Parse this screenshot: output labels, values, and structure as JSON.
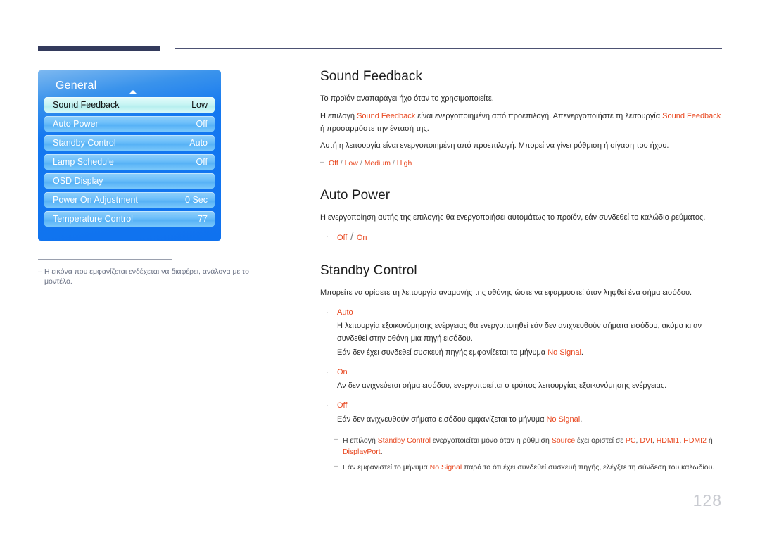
{
  "header": {
    "rule_thick_color": "#333a5c",
    "rule_thin_color": "#4d5273"
  },
  "osd": {
    "title": "General",
    "rows": [
      {
        "label": "Sound Feedback",
        "value": "Low",
        "selected": true
      },
      {
        "label": "Auto Power",
        "value": "Off",
        "selected": false
      },
      {
        "label": "Standby Control",
        "value": "Auto",
        "selected": false
      },
      {
        "label": "Lamp Schedule",
        "value": "Off",
        "selected": false
      },
      {
        "label": "OSD Display",
        "value": "",
        "selected": false
      },
      {
        "label": "Power On Adjustment",
        "value": "0 Sec",
        "selected": false
      },
      {
        "label": "Temperature Control",
        "value": "77",
        "selected": false
      }
    ],
    "caption_dash": "–",
    "caption": "Η εικόνα που εμφανίζεται ενδέχεται να διαφέρει, ανάλογα με το μοντέλο."
  },
  "sections": {
    "sound_feedback": {
      "title": "Sound Feedback",
      "p1": "Το προϊόν αναπαράγει ήχο όταν το χρησιμοποιείτε.",
      "p2_a": "Η επιλογή ",
      "p2_hl1": "Sound Feedback",
      "p2_b": " είναι ενεργοποιημένη από προεπιλογή. Απενεργοποιήστε τη λειτουργία ",
      "p2_hl2": "Sound Feedback",
      "p2_c": " ή προσαρμόστε την έντασή της.",
      "p3": "Αυτή η λειτουργία είναι ενεργοποιημένη από προεπιλογή. Μπορεί να γίνει ρύθμιση ή σίγαση του ήχου.",
      "note_dash": "–",
      "options": [
        "Off",
        "Low",
        "Medium",
        "High"
      ],
      "options_sep": "/"
    },
    "auto_power": {
      "title": "Auto Power",
      "p1": "Η ενεργοποίηση αυτής της επιλογής θα ενεργοποιήσει αυτομάτως το προϊόν, εάν συνδεθεί το καλώδιο ρεύματος.",
      "bullet_dot": "·",
      "options": [
        "Off",
        "On"
      ],
      "options_sep": "/"
    },
    "standby_control": {
      "title": "Standby Control",
      "p1": "Μπορείτε να ορίσετε τη λειτουργία αναμονής της οθόνης ώστε να εφαρμοστεί όταν ληφθεί ένα σήμα εισόδου.",
      "bullet_dot": "·",
      "items": [
        {
          "term": "Auto",
          "line1": "Η λειτουργία εξοικονόμησης ενέργειας θα ενεργοποιηθεί εάν δεν ανιχνευθούν σήματα εισόδου, ακόμα κι αν συνδεθεί στην οθόνη μια πηγή εισόδου.",
          "line2_a": "Εάν δεν έχει συνδεθεί συσκευή πηγής εμφανίζεται το μήνυμα ",
          "line2_hl": "No Signal",
          "line2_b": "."
        },
        {
          "term": "On",
          "line1": "Αν δεν ανιχνεύεται σήμα εισόδου, ενεργοποιείται ο τρόπος λειτουργίας εξοικονόμησης ενέργειας.",
          "line2_a": "",
          "line2_hl": "",
          "line2_b": ""
        },
        {
          "term": "Off",
          "line1": "",
          "line2_a": "Εάν δεν ανιχνευθούν σήματα εισόδου εμφανίζεται το μήνυμα ",
          "line2_hl": "No Signal",
          "line2_b": "."
        }
      ],
      "note_dash": "–",
      "note1_a": "Η επιλογή ",
      "note1_hl1": "Standby Control",
      "note1_b": " ενεργοποιείται μόνο όταν η ρύθμιση ",
      "note1_hl2": "Source",
      "note1_c": " έχει οριστεί σε ",
      "note1_hl3": "PC",
      "note1_d": ", ",
      "note1_hl4": "DVI",
      "note1_e": ", ",
      "note1_hl5": "HDMI1",
      "note1_f": ", ",
      "note1_hl6": "HDMI2",
      "note1_g": " ή ",
      "note1_hl7": "DisplayPort",
      "note1_h": ".",
      "note2_a": "Εάν εμφανιστεί το μήνυμα ",
      "note2_hl": "No Signal",
      "note2_b": " παρά το ότι έχει συνδεθεί συσκευή πηγής, ελέγξτε τη σύνδεση του καλωδίου."
    }
  },
  "footer": {
    "page_number": "128"
  },
  "colors": {
    "highlight": "#e8461e",
    "heading": "#1b1b1b",
    "page_number": "#c9cbd1",
    "osd_panel_blue": "#0f72ef",
    "osd_selected": "#c9f5f4"
  }
}
